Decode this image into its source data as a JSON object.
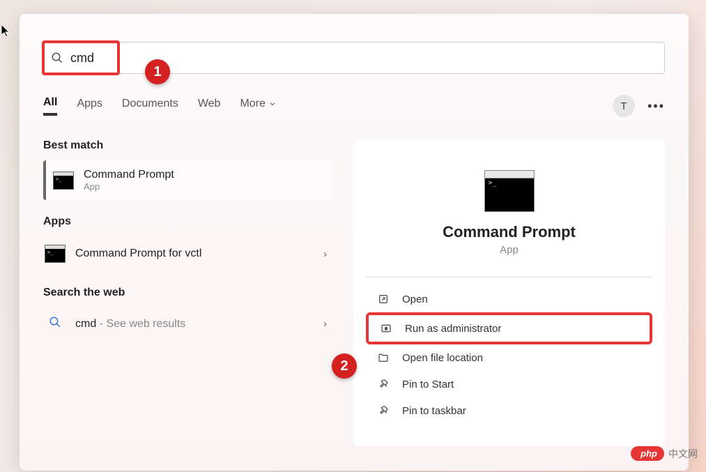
{
  "search": {
    "value": "cmd"
  },
  "annotations": {
    "one": "1",
    "two": "2"
  },
  "tabs": {
    "all": "All",
    "apps": "Apps",
    "documents": "Documents",
    "web": "Web",
    "more": "More"
  },
  "user": {
    "initial": "T"
  },
  "left": {
    "best_match_label": "Best match",
    "best_match": {
      "title": "Command Prompt",
      "sub": "App"
    },
    "apps_label": "Apps",
    "apps_item": {
      "title": "Command Prompt for vctl"
    },
    "web_label": "Search the web",
    "web_item": {
      "term": "cmd",
      "suffix": " - See web results"
    }
  },
  "preview": {
    "title": "Command Prompt",
    "sub": "App",
    "actions": {
      "open": "Open",
      "run_admin": "Run as administrator",
      "open_location": "Open file location",
      "pin_start": "Pin to Start",
      "pin_taskbar": "Pin to taskbar"
    }
  },
  "watermark": {
    "badge": "php",
    "text": "中文网"
  }
}
